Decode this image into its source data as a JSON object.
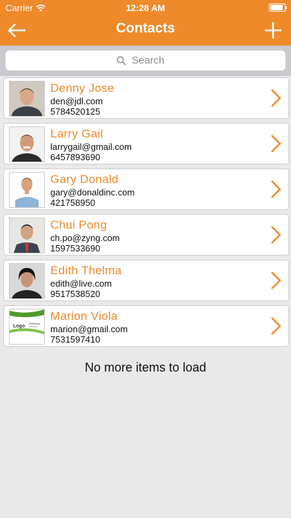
{
  "status": {
    "carrier": "Carrier",
    "time": "12:28 AM"
  },
  "nav": {
    "title": "Contacts",
    "back_icon": "arrow-left-icon",
    "add_icon": "plus-icon"
  },
  "search": {
    "placeholder": "Search"
  },
  "contacts": [
    {
      "name": "Denny Jose",
      "email": "den@jdl.com",
      "phone": "5784520125"
    },
    {
      "name": "Larry Gail",
      "email": "larrygail@gmail.com",
      "phone": "6457893690"
    },
    {
      "name": "Gary Donald",
      "email": "gary@donaldinc.com",
      "phone": "421758950"
    },
    {
      "name": "Chui Pong",
      "email": "ch.po@zyng.com",
      "phone": "1597533690"
    },
    {
      "name": "Edith Thelma",
      "email": "edith@live.com",
      "phone": "9517538520"
    },
    {
      "name": "Marion Viola",
      "email": "marion@gmail.com",
      "phone": "7531597410"
    }
  ],
  "footer": {
    "text": "No more items to load"
  },
  "card_logo": {
    "text": "Logo"
  },
  "colors": {
    "accent": "#ef8a2b",
    "background": "#e9e9e9"
  }
}
